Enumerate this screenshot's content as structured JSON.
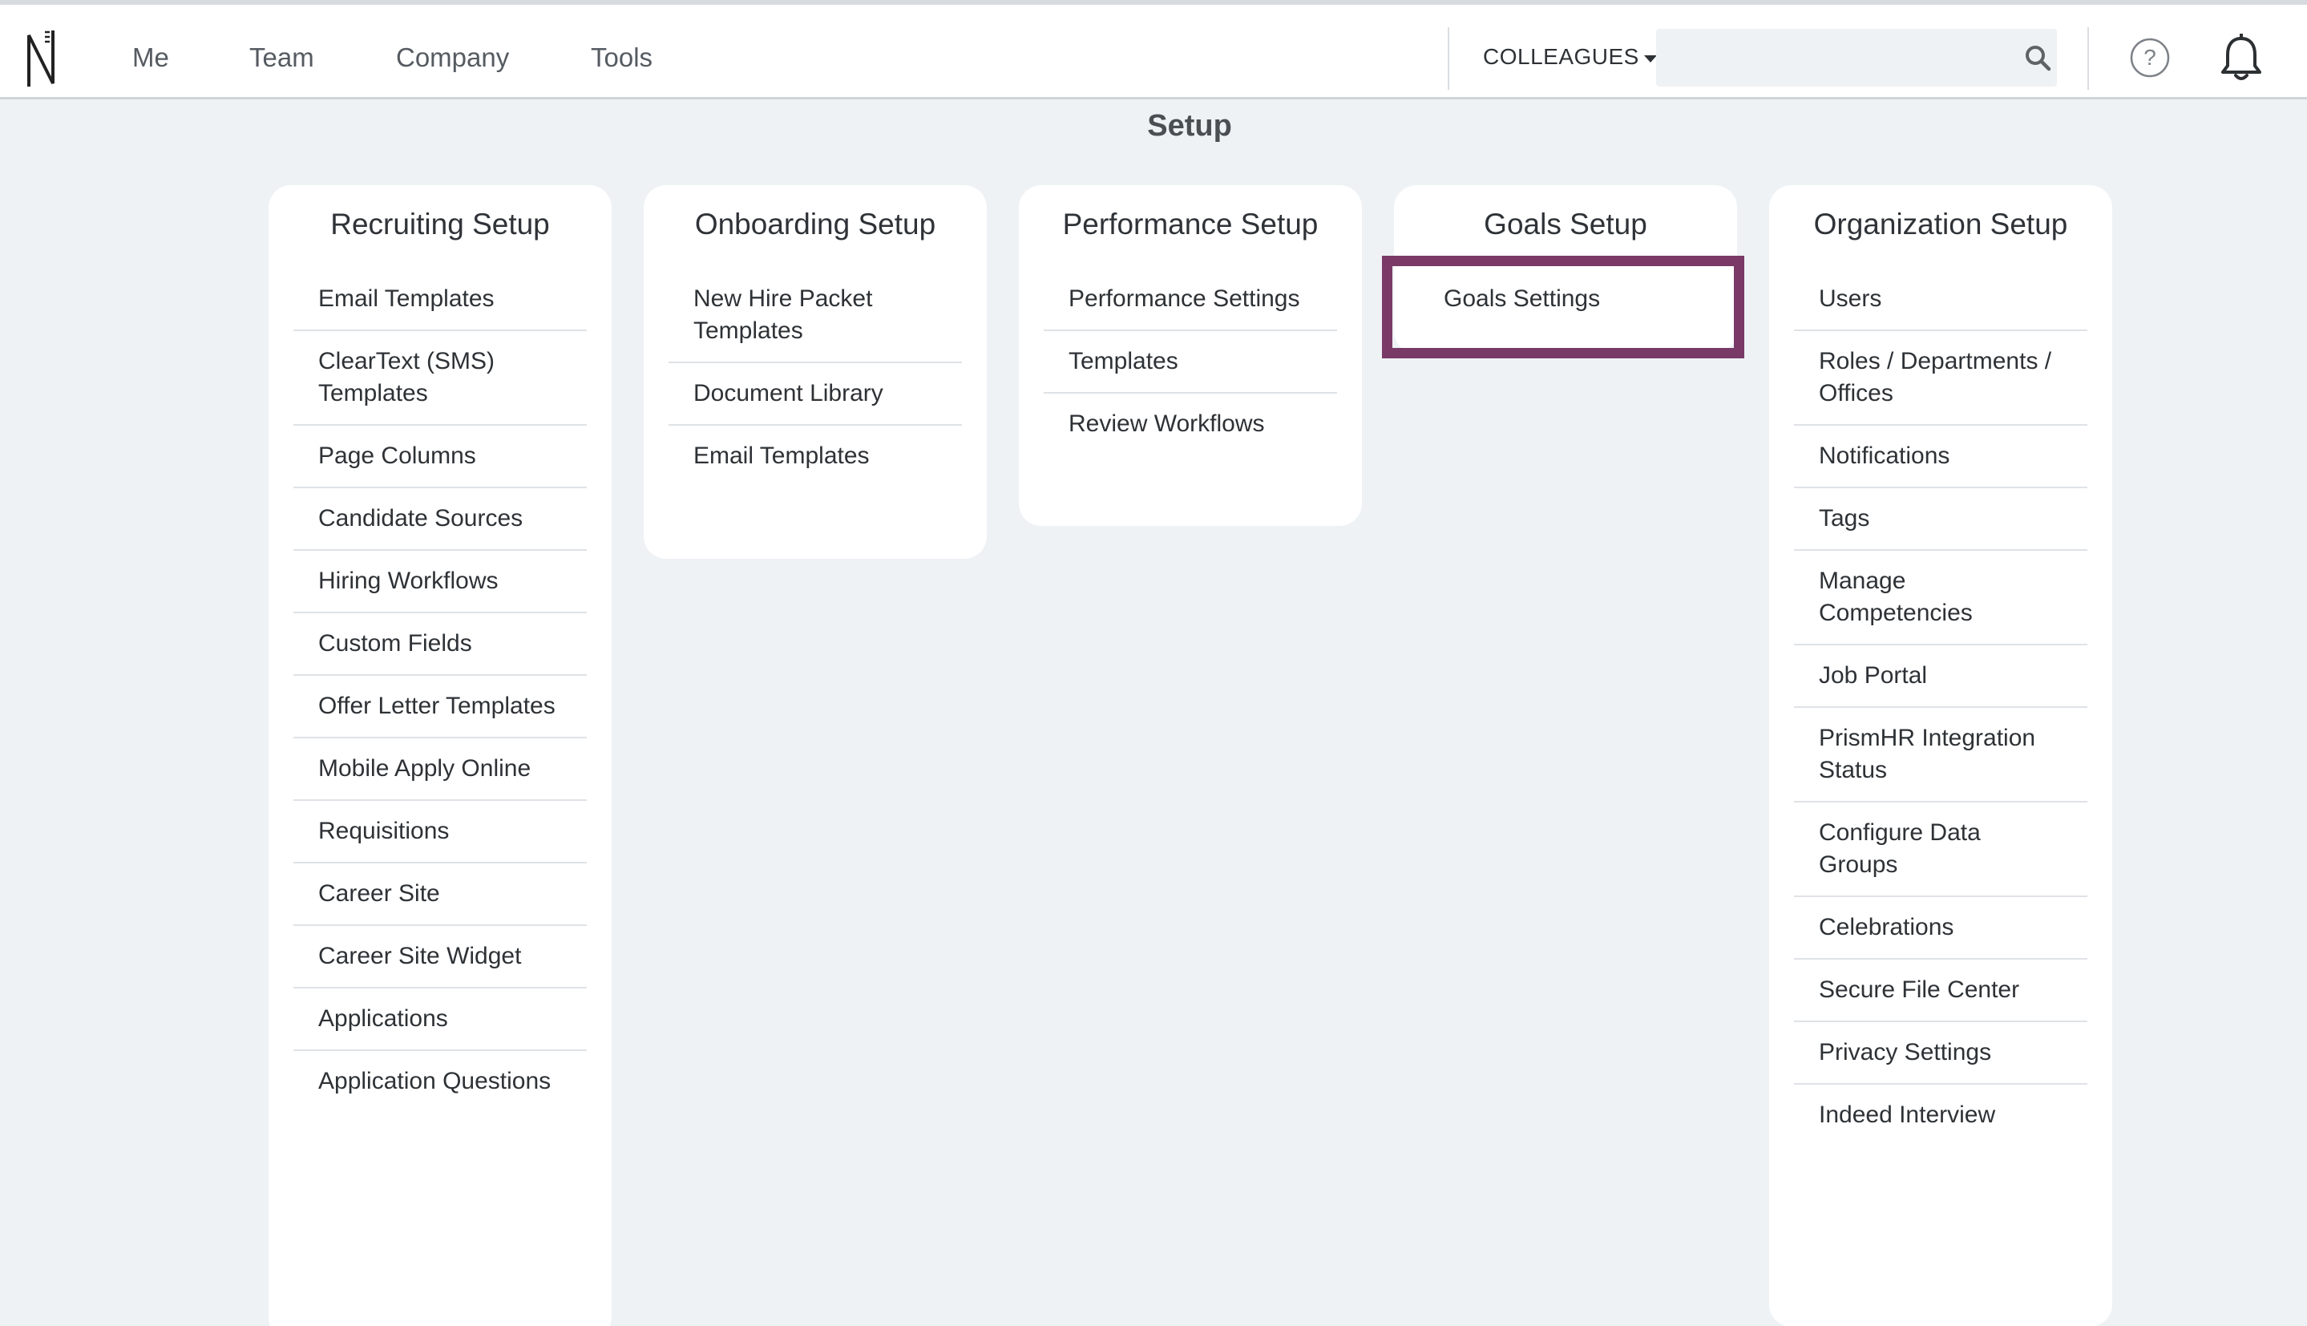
{
  "topbar": {
    "nav": [
      "Me",
      "Team",
      "Company",
      "Tools"
    ],
    "colleagues_label": "COLLEAGUES",
    "search": {
      "value": "",
      "placeholder": ""
    }
  },
  "page_title": "Setup",
  "colors": {
    "highlight": "#7a3a67",
    "background": "#eef2f5"
  },
  "sections": [
    {
      "title": "Recruiting Setup",
      "items": [
        "Email Templates",
        "ClearText (SMS) Templates",
        "Page Columns",
        "Candidate Sources",
        "Hiring Workflows",
        "Custom Fields",
        "Offer Letter Templates",
        "Mobile Apply Online",
        "Requisitions",
        "Career Site",
        "Career Site Widget",
        "Applications",
        "Application Questions"
      ]
    },
    {
      "title": "Onboarding Setup",
      "items": [
        "New Hire Packet Templates",
        "Document Library",
        "Email Templates"
      ]
    },
    {
      "title": "Performance Setup",
      "items": [
        "Performance Settings",
        "Templates",
        "Review Workflows"
      ]
    },
    {
      "title": "Goals Setup",
      "items": [
        "Goals Settings"
      ]
    },
    {
      "title": "Organization Setup",
      "items": [
        "Users",
        "Roles / Departments / Offices",
        "Notifications",
        "Tags",
        "Manage Competencies",
        "Job Portal",
        "PrismHR Integration Status",
        "Configure Data Groups",
        "Celebrations",
        "Secure File Center",
        "Privacy Settings",
        "Indeed Interview"
      ]
    }
  ]
}
